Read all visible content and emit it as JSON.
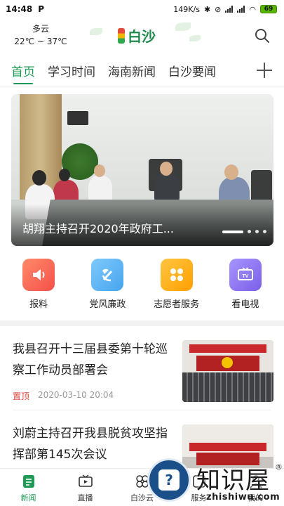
{
  "status_bar": {
    "time": "14:48",
    "carrier_badge": "P",
    "net_speed": "149K/s",
    "battery": "69"
  },
  "header": {
    "weather_condition": "多云",
    "temperature_range": "22℃ ~ 37℃",
    "logo_text": "白沙"
  },
  "tabs": [
    "首页",
    "学习时间",
    "海南新闻",
    "白沙要闻"
  ],
  "banner": {
    "caption": "胡翔主持召开2020年政府工...",
    "slide_index": 1
  },
  "quick_entries": [
    {
      "label": "报料",
      "icon": "speaker-icon",
      "color": "#ff6a55"
    },
    {
      "label": "党风廉政",
      "icon": "party-emblem-icon",
      "color": "#5ab6f5"
    },
    {
      "label": "志愿者服务",
      "icon": "clover-icon",
      "color": "#ffb300"
    },
    {
      "label": "看电视",
      "icon": "tv-icon",
      "color": "#8f78f0"
    }
  ],
  "news": [
    {
      "title": "我县召开十三届县委第十轮巡察工作动员部署会",
      "tag": "置顶",
      "time": "2020-03-10 20:04"
    },
    {
      "title": "刘蔚主持召开我县脱贫攻坚指挥部第145次会议",
      "tag": "",
      "time": ""
    }
  ],
  "bottom_nav": [
    {
      "label": "新闻",
      "icon": "news-icon",
      "active": true
    },
    {
      "label": "直播",
      "icon": "live-tv-icon",
      "active": false
    },
    {
      "label": "白沙云",
      "icon": "cloud-icon",
      "active": false
    },
    {
      "label": "服务",
      "icon": "service-icon",
      "active": false
    },
    {
      "label": "我的",
      "icon": "profile-icon",
      "active": false
    }
  ],
  "watermark": {
    "text_cn": "知识屋",
    "text_en": "zhishiwu.com",
    "mark": "®"
  },
  "colors": {
    "accent": "#1f9a56",
    "top_tag": "#e0473b"
  }
}
